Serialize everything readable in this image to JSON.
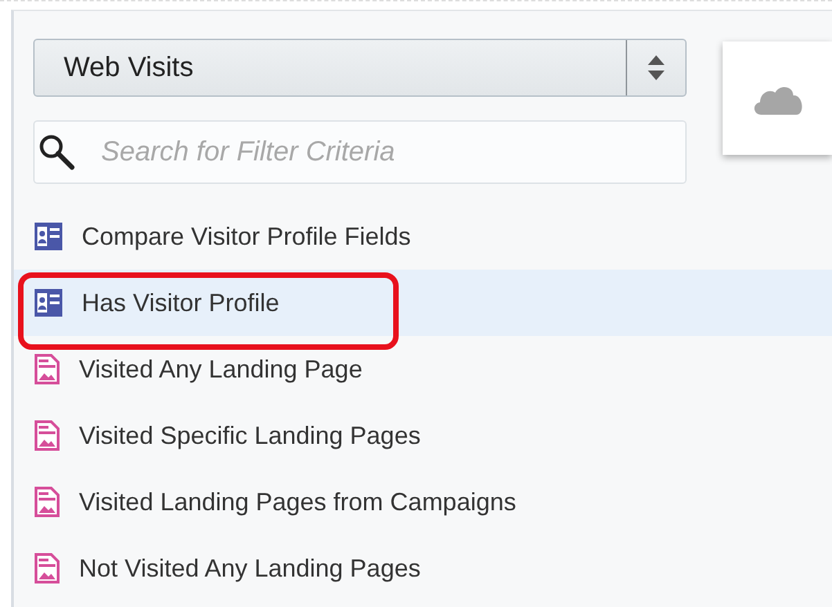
{
  "dropdown": {
    "value": "Web Visits"
  },
  "search": {
    "placeholder": "Search for Filter Criteria"
  },
  "items": [
    {
      "label": "Compare Visitor Profile Fields",
      "kind": "profile",
      "selected": false,
      "annotated": false
    },
    {
      "label": "Has Visitor Profile",
      "kind": "profile",
      "selected": true,
      "annotated": true
    },
    {
      "label": "Visited Any Landing Page",
      "kind": "landing-page",
      "selected": false,
      "annotated": false
    },
    {
      "label": "Visited Specific Landing Pages",
      "kind": "landing-page",
      "selected": false,
      "annotated": false
    },
    {
      "label": "Visited Landing Pages from Campaigns",
      "kind": "landing-page",
      "selected": false,
      "annotated": false
    },
    {
      "label": "Not Visited Any Landing Pages",
      "kind": "landing-page",
      "selected": false,
      "annotated": false
    }
  ]
}
